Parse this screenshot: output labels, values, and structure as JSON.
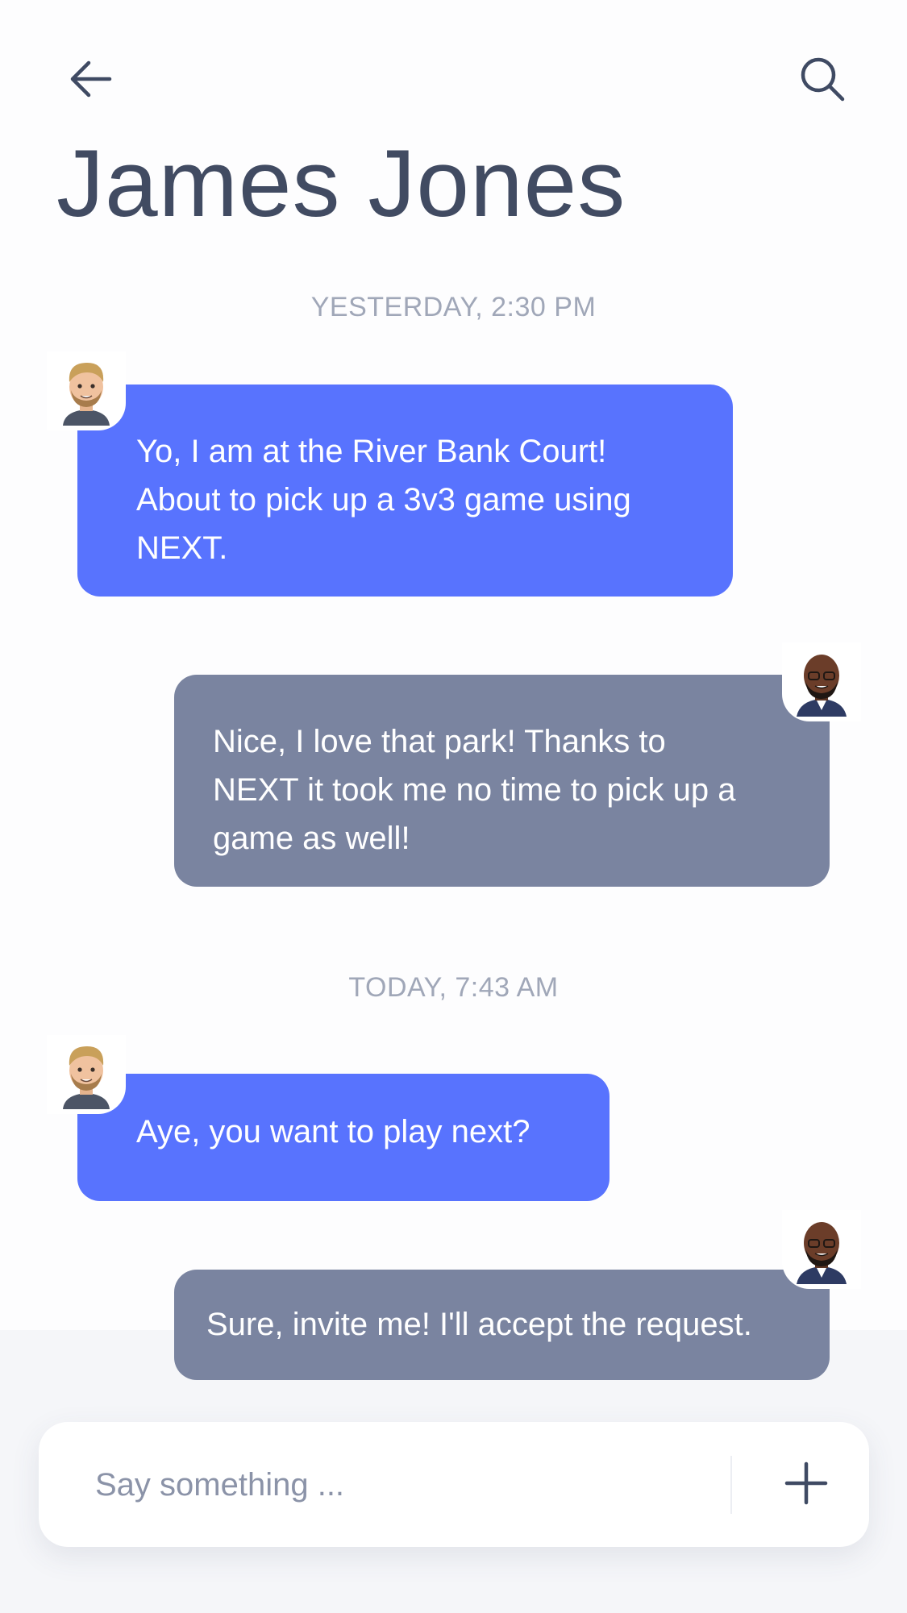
{
  "header": {
    "title": "James Jones",
    "back_icon": "arrow-left-icon",
    "search_icon": "search-icon"
  },
  "colors": {
    "incoming_bubble": "#5873fe",
    "outgoing_bubble": "#7a84a0",
    "title": "#414b62",
    "timestamp": "#a0a7b8"
  },
  "conversation": {
    "groups": [
      {
        "timestamp": "YESTERDAY, 2:30 PM",
        "messages": [
          {
            "sender": "them",
            "lines": [
              "Yo, I am at the River Bank Court!",
              "About to pick up a 3v3 game using",
              "NEXT."
            ]
          },
          {
            "sender": "me",
            "lines": [
              "Nice, I love that park! Thanks to",
              "NEXT it took me no time to pick up a",
              "game as well!"
            ]
          }
        ]
      },
      {
        "timestamp": "TODAY, 7:43 AM",
        "messages": [
          {
            "sender": "them",
            "lines": [
              "Aye, you want to play next?"
            ]
          },
          {
            "sender": "me",
            "lines": [
              "Sure, invite me! I'll accept the request."
            ]
          }
        ]
      }
    ]
  },
  "composer": {
    "placeholder": "Say something ...",
    "value": "",
    "add_icon": "plus-icon"
  }
}
